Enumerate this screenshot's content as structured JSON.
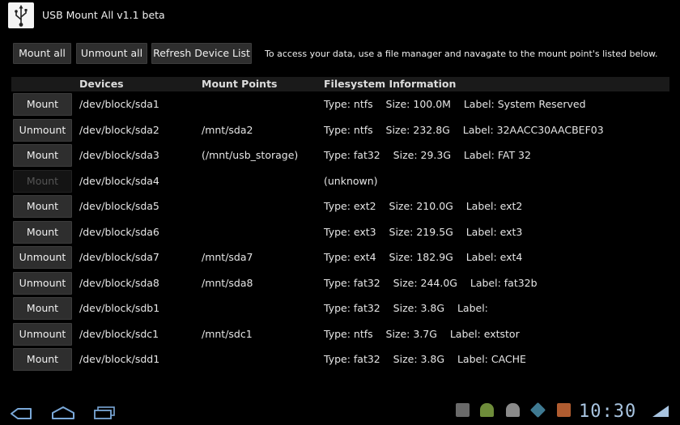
{
  "app": {
    "title": "USB Mount All v1.1 beta",
    "icon": "usb-icon"
  },
  "toolbar": {
    "mount_all_label": "Mount all",
    "unmount_all_label": "Unmount all",
    "refresh_label": "Refresh Device List",
    "hint": "To access your data, use a file manager and navagate to the mount point's listed below."
  },
  "table": {
    "headers": {
      "devices": "Devices",
      "mount_points": "Mount Points",
      "filesystem": "Filesystem Information"
    },
    "rows": [
      {
        "action": "Mount",
        "enabled": true,
        "device": "/dev/block/sda1",
        "mount_point": "",
        "fs": "Type: ntfs    Size: 100.0M    Label: System Reserved"
      },
      {
        "action": "Unmount",
        "enabled": true,
        "device": "/dev/block/sda2",
        "mount_point": "/mnt/sda2",
        "fs": "Type: ntfs    Size: 232.8G    Label: 32AACC30AACBEF03"
      },
      {
        "action": "Mount",
        "enabled": true,
        "device": "/dev/block/sda3",
        "mount_point": "(/mnt/usb_storage)",
        "fs": "Type: fat32    Size: 29.3G    Label: FAT 32"
      },
      {
        "action": "Mount",
        "enabled": false,
        "device": "/dev/block/sda4",
        "mount_point": "",
        "fs": "(unknown)"
      },
      {
        "action": "Mount",
        "enabled": true,
        "device": "/dev/block/sda5",
        "mount_point": "",
        "fs": "Type: ext2    Size: 210.0G    Label: ext2"
      },
      {
        "action": "Mount",
        "enabled": true,
        "device": "/dev/block/sda6",
        "mount_point": "",
        "fs": "Type: ext3    Size: 219.5G    Label: ext3"
      },
      {
        "action": "Unmount",
        "enabled": true,
        "device": "/dev/block/sda7",
        "mount_point": "/mnt/sda7",
        "fs": "Type: ext4    Size: 182.9G    Label: ext4"
      },
      {
        "action": "Unmount",
        "enabled": true,
        "device": "/dev/block/sda8",
        "mount_point": "/mnt/sda8",
        "fs": "Type: fat32    Size: 244.0G    Label: fat32b"
      },
      {
        "action": "Mount",
        "enabled": true,
        "device": "/dev/block/sdb1",
        "mount_point": "",
        "fs": "Type: fat32    Size: 3.8G    Label:"
      },
      {
        "action": "Unmount",
        "enabled": true,
        "device": "/dev/block/sdc1",
        "mount_point": "/mnt/sdc1",
        "fs": "Type: ntfs    Size: 3.7G    Label: extstor"
      },
      {
        "action": "Mount",
        "enabled": true,
        "device": "/dev/block/sdd1",
        "mount_point": "",
        "fs": "Type: fat32    Size: 3.8G    Label: CACHE"
      }
    ]
  },
  "system_bar": {
    "clock": "10:30",
    "nav_icons": [
      "back-icon",
      "home-icon",
      "recent-apps-icon"
    ],
    "status_icons": [
      "gallery-notification-icon",
      "android-notification-icon",
      "usb-debug-icon",
      "app-notification-icon",
      "calendar-notification-icon"
    ],
    "clock_color": "#a8c4e0"
  }
}
